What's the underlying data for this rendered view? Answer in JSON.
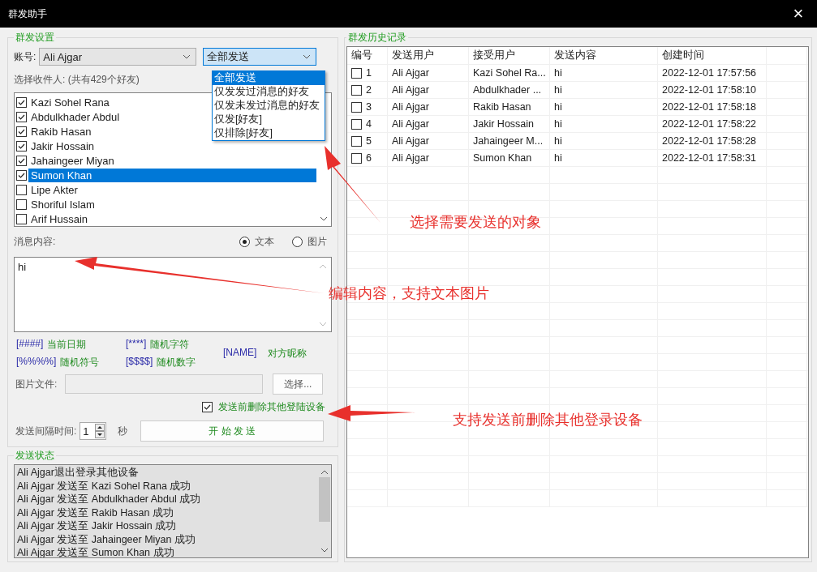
{
  "window": {
    "title": "群发助手",
    "close": "×"
  },
  "settings": {
    "title": "群发设置",
    "account_label": "账号:",
    "account": "Ali Ajgar",
    "filter": "全部发送",
    "filter_options": [
      {
        "label": "全部发送",
        "selected": true
      },
      {
        "label": "仅发发过消息的好友",
        "selected": false
      },
      {
        "label": "仅发未发过消息的好友",
        "selected": false
      },
      {
        "label": "仅发[好友]",
        "selected": false
      },
      {
        "label": "仅排除[好友]",
        "selected": false
      }
    ],
    "recipients_label": "选择收件人: (共有429个好友)",
    "recipients": [
      {
        "name": "Kazi Sohel Rana",
        "checked": true,
        "selected": false
      },
      {
        "name": "Abdulkhader Abdul",
        "checked": true,
        "selected": false
      },
      {
        "name": "Rakib Hasan",
        "checked": true,
        "selected": false
      },
      {
        "name": "Jakir Hossain",
        "checked": true,
        "selected": false
      },
      {
        "name": "Jahaingeer Miyan",
        "checked": true,
        "selected": false
      },
      {
        "name": "Sumon Khan",
        "checked": true,
        "selected": true
      },
      {
        "name": "Lipe Akter",
        "checked": false,
        "selected": false
      },
      {
        "name": "Shoriful Islam",
        "checked": false,
        "selected": false
      },
      {
        "name": "Arif Hussain",
        "checked": false,
        "selected": false
      }
    ],
    "message_label": "消息内容:",
    "message_types": [
      {
        "label": "文本",
        "selected": true
      },
      {
        "label": "图片",
        "selected": false
      }
    ],
    "message": "hi",
    "placeholders": [
      {
        "code": "[####]",
        "meaning": "当前日期"
      },
      {
        "code": "[****]",
        "meaning": "随机字符"
      },
      {
        "code": "[NAME]",
        "meaning": "对方昵称"
      },
      {
        "code": "[%%%%]",
        "meaning": "随机符号"
      },
      {
        "code": "[$$$$]",
        "meaning": "随机数字"
      }
    ],
    "image_file_label": "图片文件:",
    "choose_button": "选择...",
    "delete_devices": {
      "label": "发送前删除其他登陆设备",
      "checked": true
    },
    "interval_label": "发送间隔时间:",
    "interval": "1",
    "interval_unit": "秒",
    "start_button": "开 始 发 送"
  },
  "status": {
    "title": "发送状态",
    "lines": [
      "Ali Ajgar退出登录其他设备",
      "Ali Ajgar 发送至 Kazi Sohel Rana 成功",
      "Ali Ajgar 发送至 Abdulkhader Abdul 成功",
      "Ali Ajgar 发送至 Rakib Hasan 成功",
      "Ali Ajgar 发送至 Jakir Hossain 成功",
      "Ali Ajgar 发送至 Jahaingeer Miyan 成功",
      "Ali Ajgar 发送至 Sumon Khan 成功"
    ]
  },
  "history": {
    "title": "群发历史记录",
    "columns": [
      "编号",
      "发送用户",
      "接受用户",
      "发送内容",
      "创建时间"
    ],
    "rows": [
      {
        "checked": false,
        "cells": [
          "1",
          "Ali Ajgar",
          "Kazi Sohel Ra...",
          "hi",
          "2022-12-01 17:57:56"
        ]
      },
      {
        "checked": false,
        "cells": [
          "2",
          "Ali Ajgar",
          "Abdulkhader ...",
          "hi",
          "2022-12-01 17:58:10"
        ]
      },
      {
        "checked": false,
        "cells": [
          "3",
          "Ali Ajgar",
          "Rakib Hasan",
          "hi",
          "2022-12-01 17:58:18"
        ]
      },
      {
        "checked": false,
        "cells": [
          "4",
          "Ali Ajgar",
          "Jakir Hossain",
          "hi",
          "2022-12-01 17:58:22"
        ]
      },
      {
        "checked": false,
        "cells": [
          "5",
          "Ali Ajgar",
          "Jahaingeer M...",
          "hi",
          "2022-12-01 17:58:28"
        ]
      },
      {
        "checked": false,
        "cells": [
          "6",
          "Ali Ajgar",
          "Sumon Khan",
          "hi",
          "2022-12-01 17:58:31"
        ]
      }
    ]
  },
  "annotations": [
    {
      "text": "选择需要发送的对象"
    },
    {
      "text": "编辑内容，支持文本图片"
    },
    {
      "text": "支持发送前删除其他登录设备"
    }
  ]
}
